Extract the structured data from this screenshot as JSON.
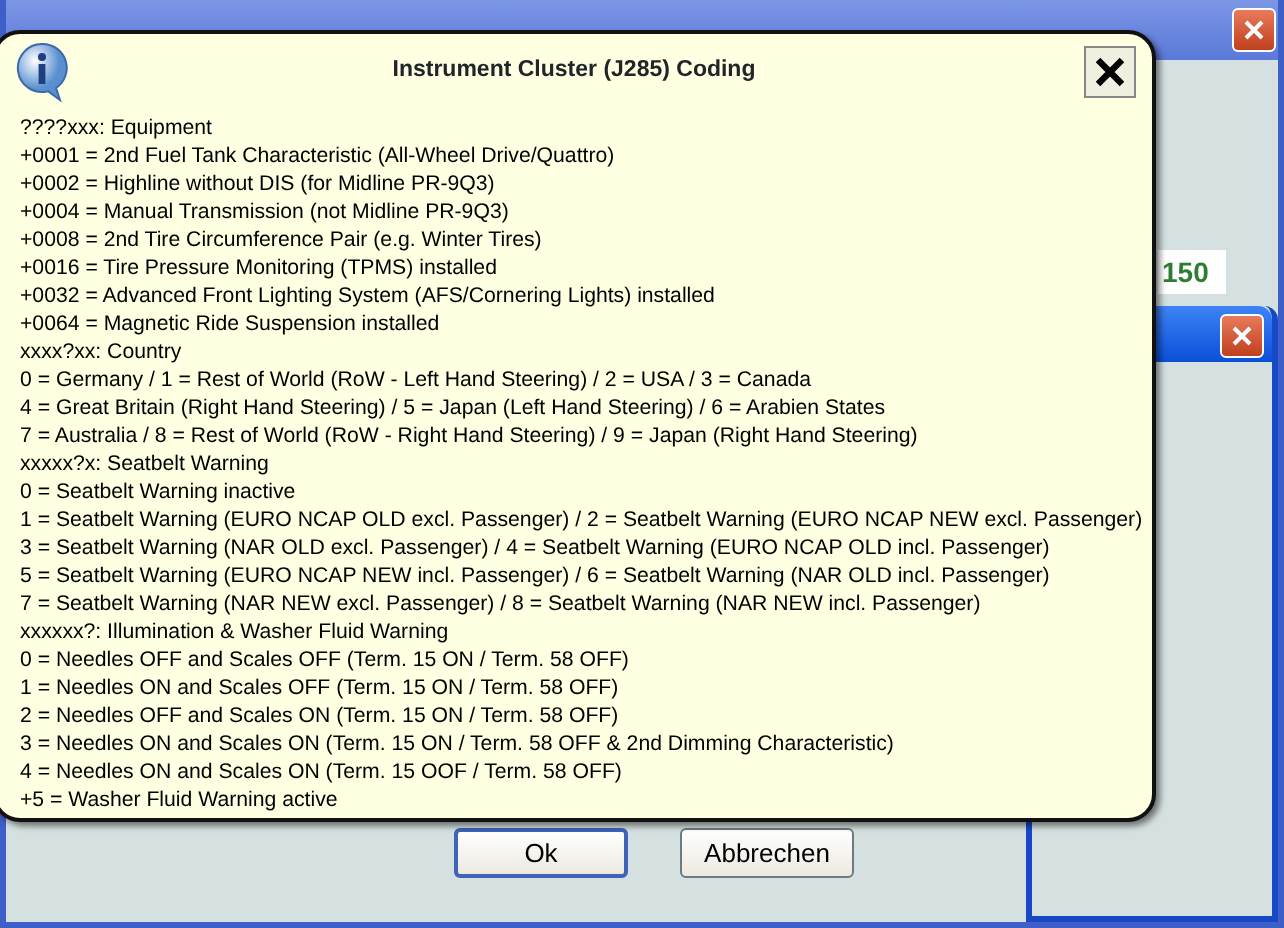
{
  "background_window": {
    "code_field": "150"
  },
  "dialog": {
    "buttons": [
      {
        "label": "Ok",
        "default": true
      },
      {
        "label": "Abbrechen",
        "default": false
      }
    ]
  },
  "popup": {
    "title": "Instrument Cluster (J285) Coding",
    "lines": [
      "????xxx: Equipment",
      "+0001 = 2nd Fuel Tank Characteristic (All-Wheel Drive/Quattro)",
      "+0002 = Highline without DIS (for Midline PR-9Q3)",
      "+0004 = Manual Transmission (not Midline PR-9Q3)",
      "+0008 = 2nd Tire Circumference Pair (e.g. Winter Tires)",
      "+0016 = Tire Pressure Monitoring (TPMS) installed",
      "+0032 = Advanced Front Lighting System (AFS/Cornering Lights) installed",
      "+0064 = Magnetic Ride Suspension installed",
      "xxxx?xx: Country",
      "0 = Germany / 1 = Rest of World (RoW - Left Hand Steering) / 2 = USA / 3 = Canada",
      "4 = Great Britain (Right Hand Steering) / 5 = Japan (Left Hand Steering) / 6 = Arabien States",
      "7 = Australia / 8 = Rest of World (RoW - Right Hand Steering) / 9 = Japan (Right Hand Steering)",
      "xxxxx?x: Seatbelt Warning",
      "0 = Seatbelt Warning inactive",
      "1 = Seatbelt Warning (EURO NCAP OLD excl. Passenger) / 2 = Seatbelt Warning (EURO NCAP NEW excl. Passenger)",
      "3 = Seatbelt Warning (NAR OLD excl. Passenger) / 4 = Seatbelt Warning (EURO NCAP OLD incl. Passenger)",
      "5 = Seatbelt Warning (EURO NCAP NEW incl. Passenger) / 6 = Seatbelt Warning (NAR OLD incl. Passenger)",
      "7 = Seatbelt Warning (NAR NEW excl. Passenger) / 8 = Seatbelt Warning (NAR NEW incl. Passenger)",
      "xxxxxx?: Illumination & Washer Fluid Warning",
      "0 = Needles OFF and Scales OFF (Term. 15 ON / Term. 58 OFF)",
      "1 = Needles ON and Scales OFF (Term. 15 ON / Term. 58 OFF)",
      "2 = Needles OFF and Scales ON (Term. 15 ON / Term. 58 OFF)",
      "3 = Needles ON and Scales ON (Term. 15 ON / Term. 58 OFF & 2nd Dimming Characteristic)",
      "4 = Needles ON and Scales ON (Term. 15 OOF / Term. 58 OFF)",
      "+5 = Washer Fluid Warning active"
    ]
  }
}
